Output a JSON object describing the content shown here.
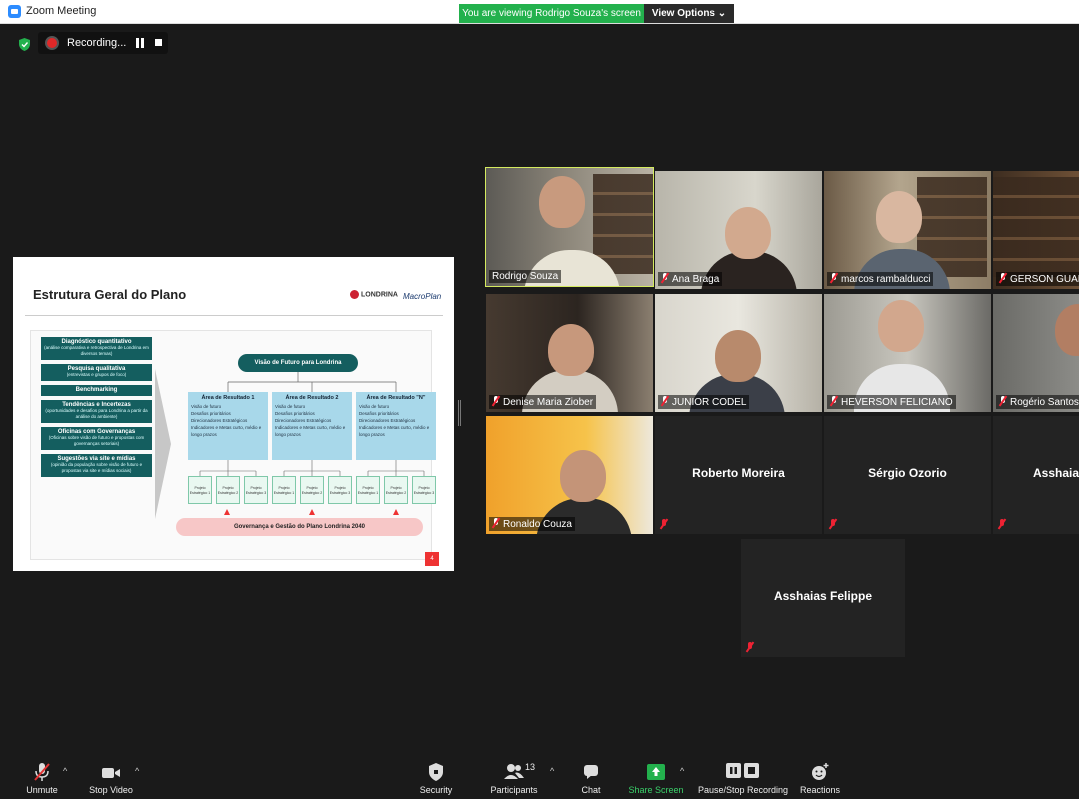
{
  "window": {
    "title": "Zoom Meeting"
  },
  "banner": {
    "viewing": "You are viewing Rodrigo Souza's screen",
    "view_options": "View Options ⌄"
  },
  "recording": {
    "label": "Recording..."
  },
  "slide": {
    "title": "Estrutura Geral do Plano",
    "logo_prefeitura": "LONDRINA",
    "logo_macroplan": "MacroPlan",
    "steps": [
      {
        "head": "Diagnóstico quantitativo",
        "sub": "(análise comparativa e retrospectiva de Londrina em diversos temas)"
      },
      {
        "head": "Pesquisa qualitativa",
        "sub": "(entrevistas e grupos de foco)"
      },
      {
        "head": "Benchmarking",
        "sub": ""
      },
      {
        "head": "Tendências e Incertezas",
        "sub": "(oportunidades e desafios para Londrina a partir da análise do ambiente)"
      },
      {
        "head": "Oficinas com Governanças",
        "sub": "(Oficinas sobre visão de futuro e propostas com governanças setoriais)"
      },
      {
        "head": "Sugestões via site e mídias",
        "sub": "(opinião da população sobre visão de futuro e propostas via site e mídias sociais)"
      }
    ],
    "vision": "Visão de Futuro para Londrina",
    "areas": [
      {
        "title": "Área de Resultado 1",
        "items": [
          "Visão de futuro",
          "Desafios prioritários",
          "Direcionadores Estratégicos",
          "Indicadores e Metas curto, médio e longo prazos"
        ]
      },
      {
        "title": "Área de Resultado 2",
        "items": [
          "Visão de futuro",
          "Desafios prioritários",
          "Direcionadores Estratégicos",
          "Indicadores e Metas curto, médio e longo prazos"
        ]
      },
      {
        "title": "Área de Resultado \"N\"",
        "items": [
          "Visão de futuro",
          "Desafios prioritários",
          "Direcionadores Estratégicos",
          "Indicadores e Metas curto, médio e longo prazos"
        ]
      }
    ],
    "projects": [
      "Projeto Estratégico 1",
      "Projeto Estratégico 2",
      "Projeto Estratégico 3"
    ],
    "governance": "Governança e Gestão do Plano Londrina 2040",
    "page": "4"
  },
  "participants": [
    {
      "name": "Rodrigo Souza",
      "muted": false,
      "video": true
    },
    {
      "name": "Ana Braga",
      "muted": true,
      "video": true
    },
    {
      "name": "marcos rambalducci",
      "muted": true,
      "video": true
    },
    {
      "name": "GERSON GUARI",
      "muted": true,
      "video": true
    },
    {
      "name": "Denise Maria Ziober",
      "muted": true,
      "video": true
    },
    {
      "name": "JUNIOR CODEL",
      "muted": true,
      "video": true
    },
    {
      "name": "HEVERSON FELICIANO",
      "muted": true,
      "video": true
    },
    {
      "name": "Rogério Santos",
      "muted": true,
      "video": true
    },
    {
      "name": "Ronaldo Couza",
      "muted": true,
      "video": true
    },
    {
      "name": "Roberto Moreira",
      "muted": true,
      "video": false
    },
    {
      "name": "Sérgio Ozorio",
      "muted": true,
      "video": false
    },
    {
      "name": "Asshaias",
      "muted": true,
      "video": false
    },
    {
      "name": "Asshaias Felippe",
      "muted": true,
      "video": false
    }
  ],
  "toolbar": {
    "unmute": "Unmute",
    "stop_video": "Stop Video",
    "security": "Security",
    "participants": "Participants",
    "participants_count": "13",
    "chat": "Chat",
    "share_screen": "Share Screen",
    "pause_stop_recording": "Pause/Stop Recording",
    "reactions": "Reactions"
  },
  "colors": {
    "accent_green": "#23b14d",
    "active_speaker": "#d4ea5f",
    "mute_red": "#e23333"
  }
}
